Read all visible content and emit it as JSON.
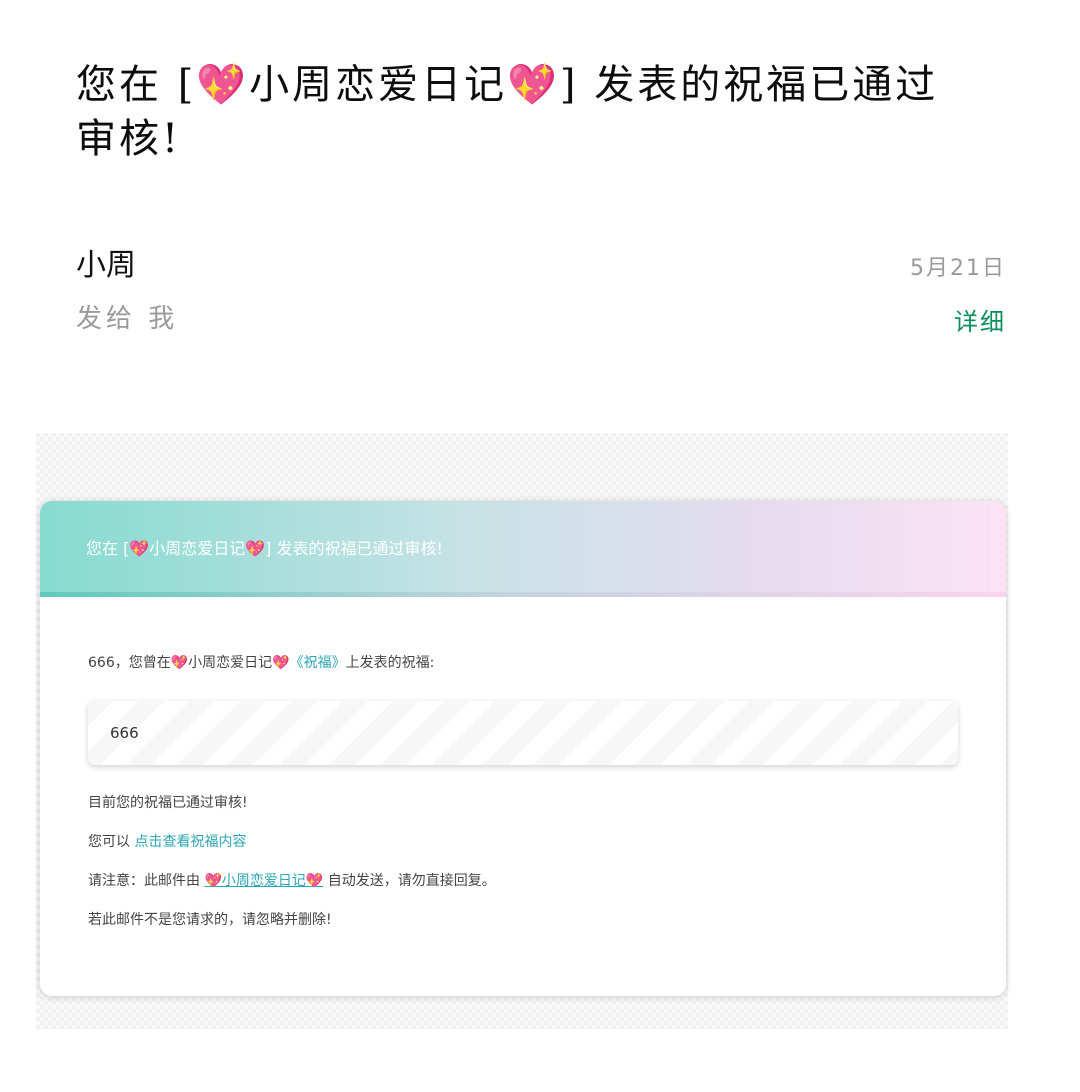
{
  "email": {
    "subject": "您在 [💖小周恋爱日记💖] 发表的祝福已通过审核!",
    "sender": "小周",
    "date": "5月21日",
    "to_line": "发给 我",
    "details_label": "详细"
  },
  "card": {
    "header_text": "您在 [💖小周恋爱日记💖] 发表的祝福已通过审核!",
    "intro_prefix": "666，您曾在💖小周恋爱日记💖",
    "intro_link": "《祝福》",
    "intro_suffix": "上发表的祝福:",
    "quote_text": "666",
    "status_text": "目前您的祝福已通过审核!",
    "view_prefix": "您可以",
    "view_link": "点击查看祝福内容",
    "notice_prefix": "请注意：此邮件由",
    "notice_link": "💖小周恋爱日记💖",
    "notice_suffix": "自动发送，请勿直接回复。",
    "ignore_text": "若此邮件不是您请求的，请忽略并删除!"
  },
  "colors": {
    "details_green": "#0b8e5a",
    "link_teal": "#2aa7b6",
    "header_gradient_start": "#86dbcf",
    "header_gradient_end": "#fce2f4"
  }
}
